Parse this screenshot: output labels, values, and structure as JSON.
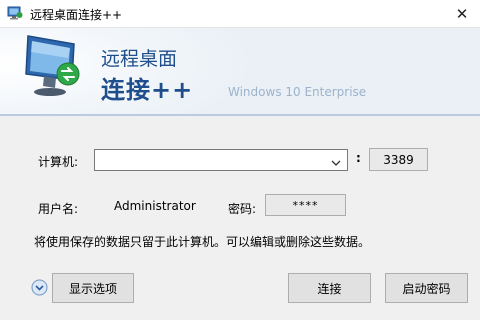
{
  "window": {
    "title": "远程桌面连接++",
    "close_glyph": "✕"
  },
  "banner": {
    "line1": "远程桌面",
    "line2": "连接++",
    "edition": "Windows 10 Enterprise"
  },
  "form": {
    "computer_label": "计算机:",
    "computer_value": "",
    "port_separator": ":",
    "port_value": "3389",
    "username_label": "用户名:",
    "username_value": "Administrator",
    "password_label": "密码:",
    "password_value": "****",
    "info_text": "将使用保存的数据只留于此计算机。可以编辑或删除这些数据。"
  },
  "buttons": {
    "show_options": "显示选项",
    "connect": "连接",
    "launch_password": "启动密码"
  },
  "colors": {
    "brand_blue": "#1f4e8c",
    "banner_bg": "#eaf0f6",
    "dialog_bg": "#f0f0f0",
    "button_bg": "#e1e1e1"
  },
  "icons": {
    "title": "rdp-monitor-icon",
    "logo": "rdp-monitor-logo-icon",
    "close": "close-icon",
    "dropdown": "chevron-down-icon",
    "expand": "expand-circle-icon"
  }
}
